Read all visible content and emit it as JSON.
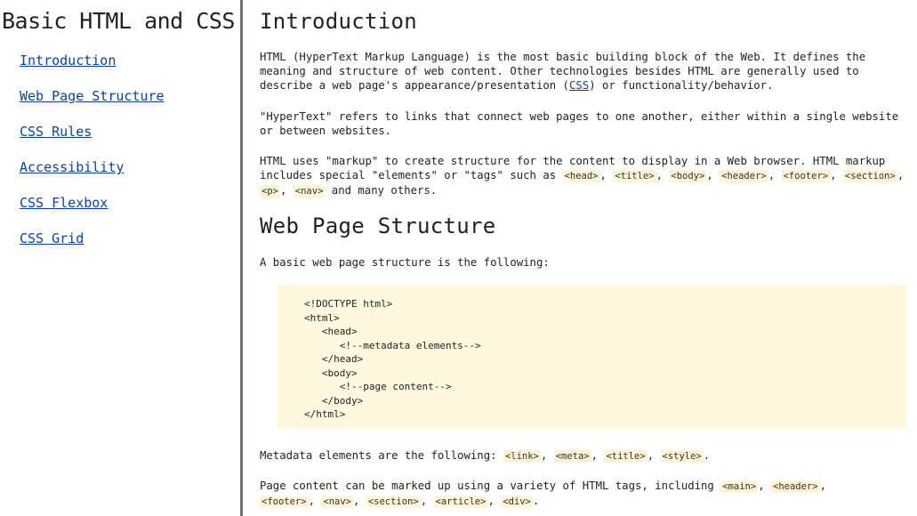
{
  "nav": {
    "title": "Basic HTML and CSS",
    "links": [
      "Introduction",
      "Web Page Structure",
      "CSS Rules",
      "Accessibility",
      "CSS Flexbox",
      "CSS Grid"
    ]
  },
  "intro": {
    "heading": "Introduction",
    "p1_a": "HTML (HyperText Markup Language) is the most basic building block of the Web. It defines the meaning and structure of web content. Other technologies besides HTML are generally used to describe a web page's appearance/presentation (",
    "p1_link": "CSS",
    "p1_b": ") or functionality/behavior.",
    "p2": "\"HyperText\" refers to links that connect web pages to one another, either within a single website or between websites.",
    "p3_a": "HTML uses \"markup\" to create structure for the content to display in a Web browser. HTML markup includes special \"elements\" or \"tags\" such as ",
    "p3_tags": [
      "<head>",
      "<title>",
      "<body>",
      "<header>",
      "<footer>",
      "<section>",
      "<p>",
      "<nav>"
    ],
    "p3_b": " and many others."
  },
  "structure": {
    "heading": "Web Page Structure",
    "p1": "A basic web page structure is the following:",
    "code_lines": [
      "<!DOCTYPE html>",
      "<html>",
      "   <head>",
      "      <!--metadata elements-->",
      "   </head>",
      "   <body>",
      "      <!--page content-->",
      "   </body>",
      "</html>"
    ],
    "p2_a": "Metadata elements are the following: ",
    "p2_tags": [
      "<link>",
      "<meta>",
      "<title>",
      "<style>"
    ],
    "p2_b": ".",
    "p3_a": "Page content can be marked up using a variety of HTML tags, including ",
    "p3_tags": [
      "<main>",
      "<header>",
      "<footer>",
      "<nav>",
      "<section>",
      "<article>",
      "<div>"
    ],
    "p3_b": "."
  }
}
